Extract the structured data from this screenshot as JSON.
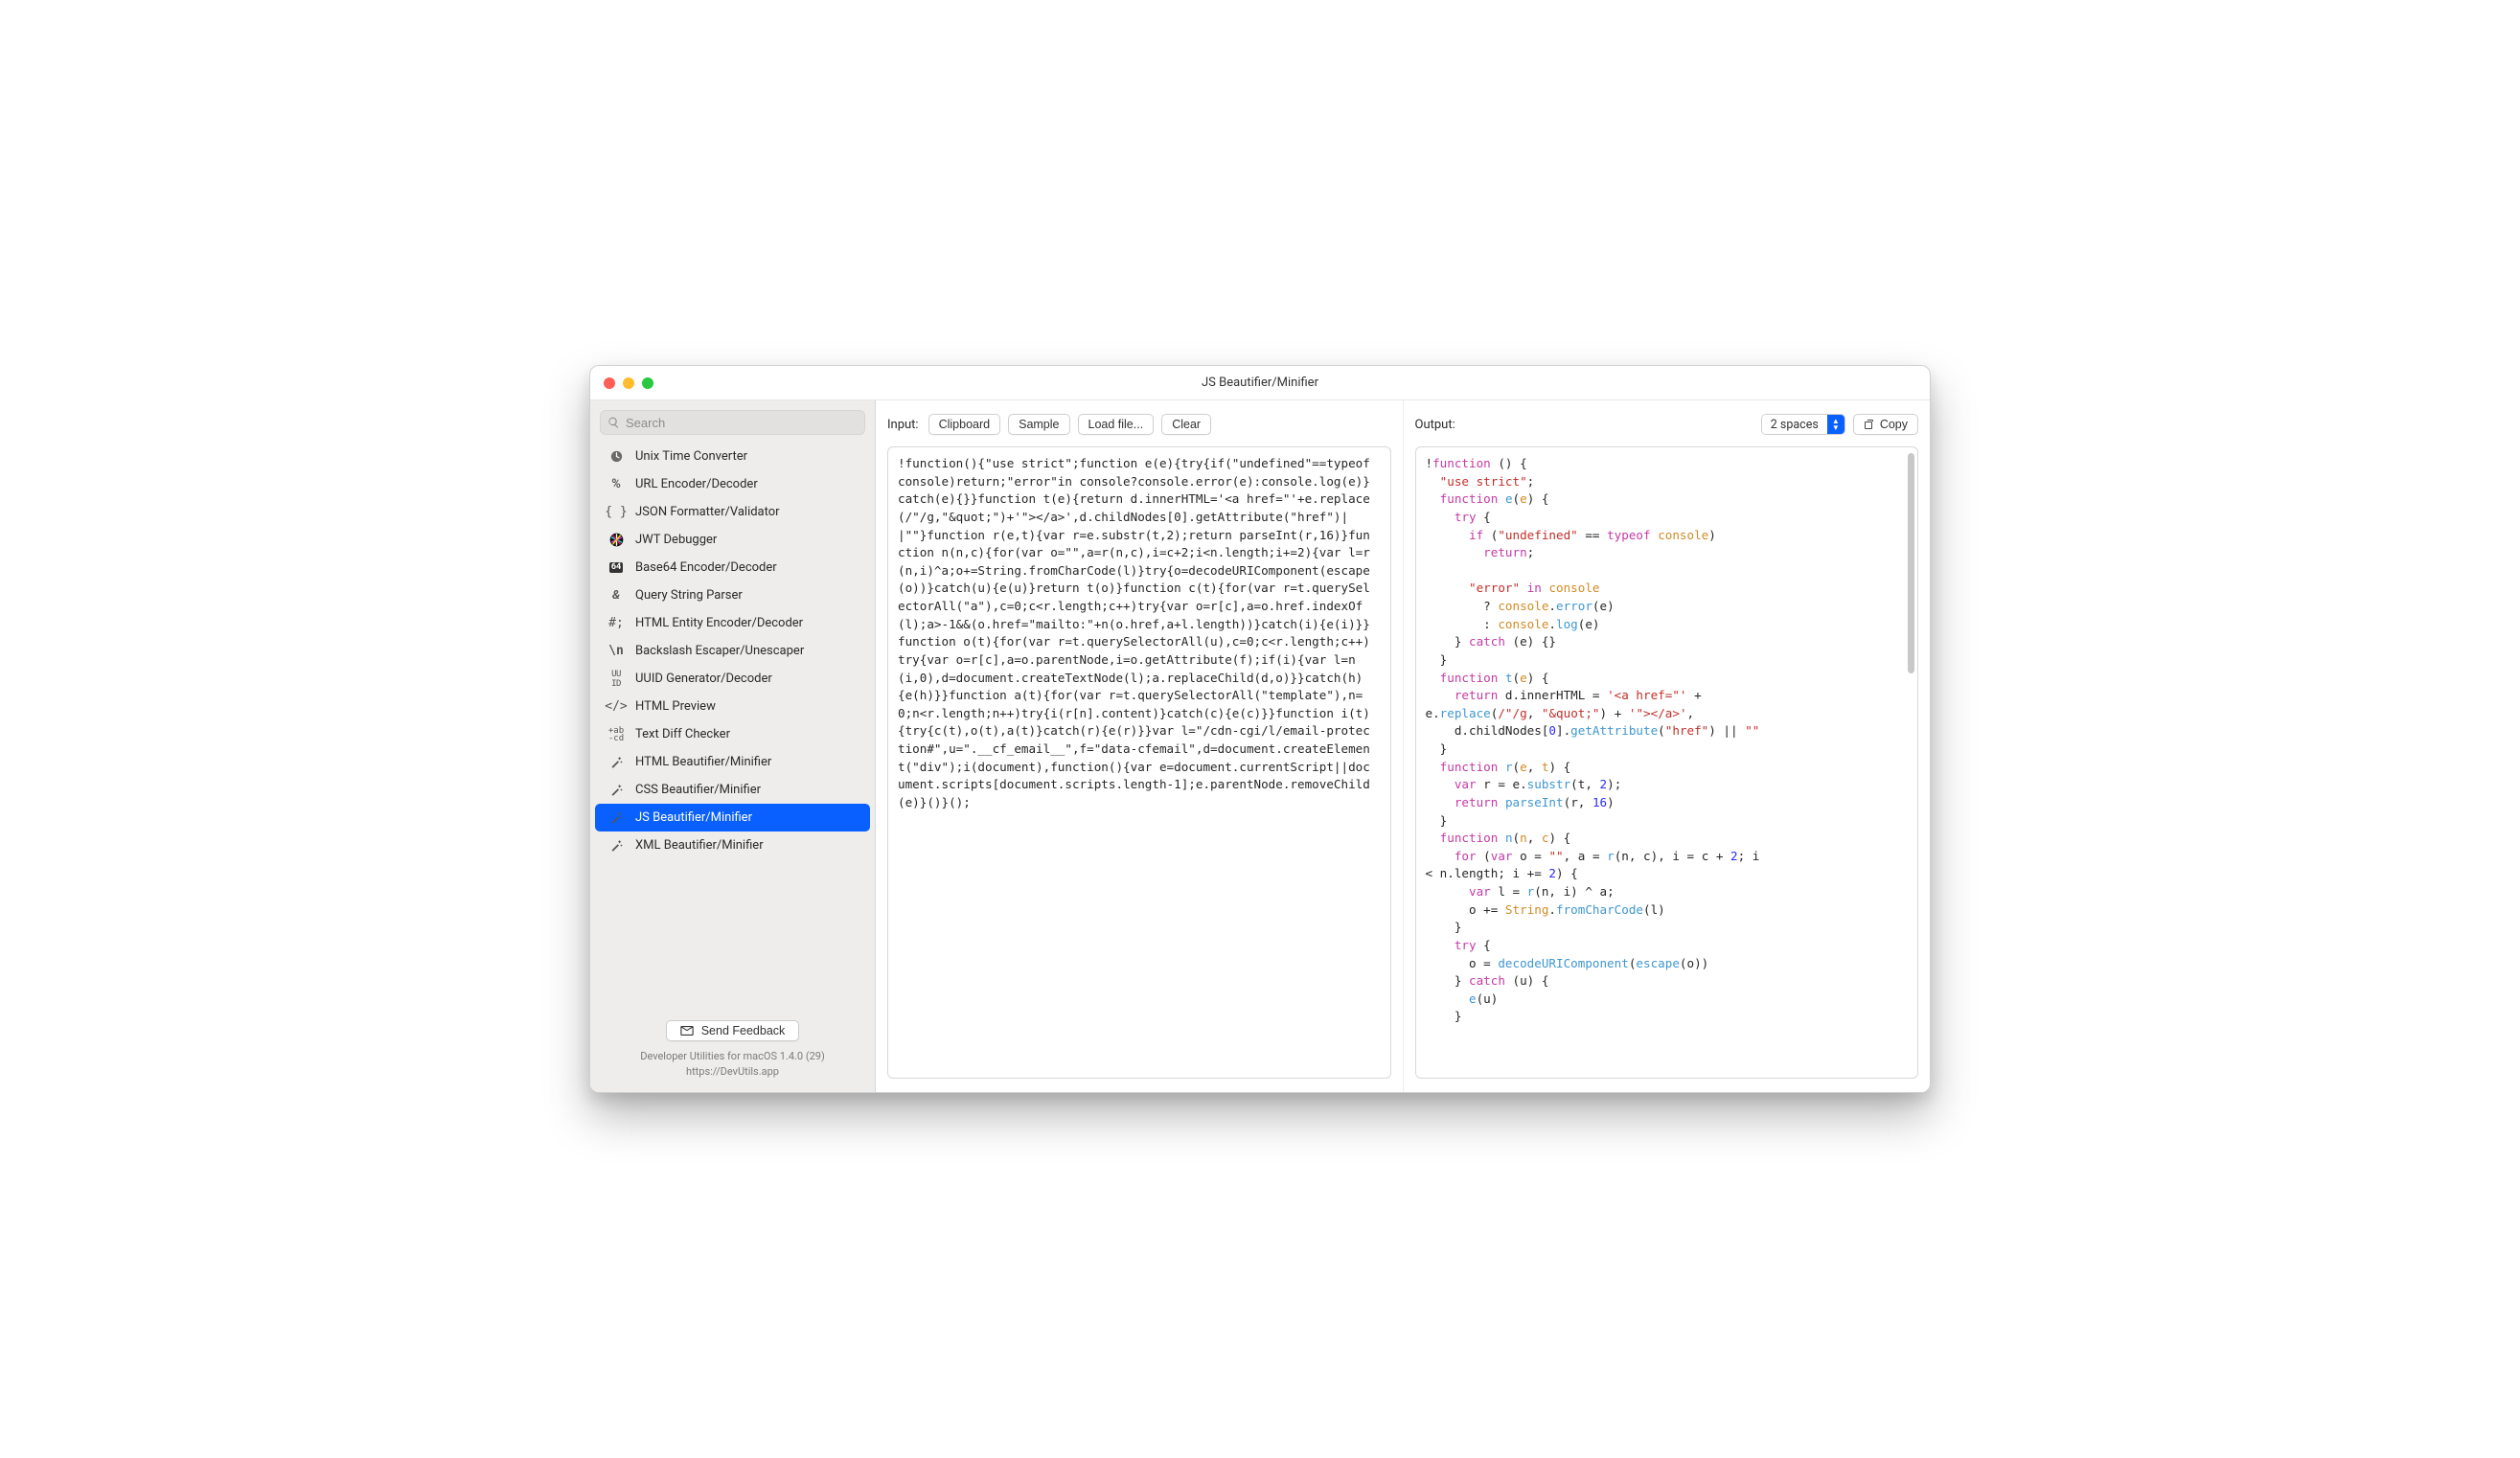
{
  "window": {
    "title": "JS Beautifier/Minifier"
  },
  "search": {
    "placeholder": "Search"
  },
  "tools": [
    {
      "id": "unix-time",
      "label": "Unix Time Converter",
      "icon": "clock"
    },
    {
      "id": "url-encoder",
      "label": "URL Encoder/Decoder",
      "icon": "percent"
    },
    {
      "id": "json-fmt",
      "label": "JSON Formatter/Validator",
      "icon": "braces"
    },
    {
      "id": "jwt",
      "label": "JWT Debugger",
      "icon": "jwt"
    },
    {
      "id": "base64",
      "label": "Base64 Encoder/Decoder",
      "icon": "b64"
    },
    {
      "id": "query-string",
      "label": "Query String Parser",
      "icon": "amp"
    },
    {
      "id": "html-entity",
      "label": "HTML Entity Encoder/Decoder",
      "icon": "hash"
    },
    {
      "id": "backslash",
      "label": "Backslash Escaper/Unescaper",
      "icon": "backslash"
    },
    {
      "id": "uuid",
      "label": "UUID Generator/Decoder",
      "icon": "uuid"
    },
    {
      "id": "html-preview",
      "label": "HTML Preview",
      "icon": "code"
    },
    {
      "id": "text-diff",
      "label": "Text Diff Checker",
      "icon": "diff"
    },
    {
      "id": "html-beautify",
      "label": "HTML Beautifier/Minifier",
      "icon": "wand"
    },
    {
      "id": "css-beautify",
      "label": "CSS Beautifier/Minifier",
      "icon": "wand"
    },
    {
      "id": "js-beautify",
      "label": "JS Beautifier/Minifier",
      "icon": "wand",
      "selected": true
    },
    {
      "id": "xml-beautify",
      "label": "XML Beautifier/Minifier",
      "icon": "wand"
    }
  ],
  "footer": {
    "feedback": "Send Feedback",
    "meta1": "Developer Utilities for macOS 1.4.0 (29)",
    "meta2": "https://DevUtils.app"
  },
  "input_pane": {
    "label": "Input:",
    "buttons": {
      "clipboard": "Clipboard",
      "sample": "Sample",
      "load": "Load file...",
      "clear": "Clear"
    },
    "code": "!function(){\"use strict\";function e(e){try{if(\"undefined\"==typeof console)return;\"error\"in console?console.error(e):console.log(e)}catch(e){}}function t(e){return d.innerHTML='<a href=\"'+e.replace(/\"/g,\"&quot;\")+'\"></a>',d.childNodes[0].getAttribute(\"href\")||\"\"}function r(e,t){var r=e.substr(t,2);return parseInt(r,16)}function n(n,c){for(var o=\"\",a=r(n,c),i=c+2;i<n.length;i+=2){var l=r(n,i)^a;o+=String.fromCharCode(l)}try{o=decodeURIComponent(escape(o))}catch(u){e(u)}return t(o)}function c(t){for(var r=t.querySelectorAll(\"a\"),c=0;c<r.length;c++)try{var o=r[c],a=o.href.indexOf(l);a>-1&&(o.href=\"mailto:\"+n(o.href,a+l.length))}catch(i){e(i)}}function o(t){for(var r=t.querySelectorAll(u),c=0;c<r.length;c++)try{var o=r[c],a=o.parentNode,i=o.getAttribute(f);if(i){var l=n(i,0),d=document.createTextNode(l);a.replaceChild(d,o)}}catch(h){e(h)}}function a(t){for(var r=t.querySelectorAll(\"template\"),n=0;n<r.length;n++)try{i(r[n].content)}catch(c){e(c)}}function i(t){try{c(t),o(t),a(t)}catch(r){e(r)}}var l=\"/cdn-cgi/l/email-protection#\",u=\".__cf_email__\",f=\"data-cfemail\",d=document.createElement(\"div\");i(document),function(){var e=document.currentScript||document.scripts[document.scripts.length-1];e.parentNode.removeChild(e)}()}();"
  },
  "output_pane": {
    "label": "Output:",
    "indent_select": "2 spaces",
    "copy": "Copy"
  }
}
